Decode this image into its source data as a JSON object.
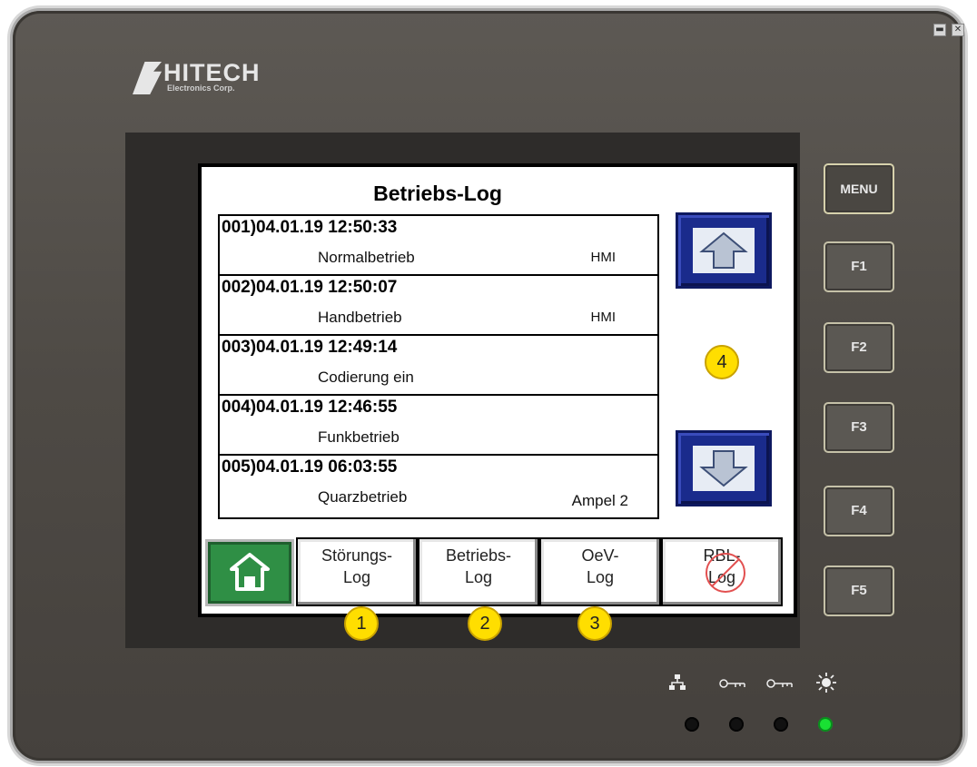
{
  "window_controls": {
    "minimize": "▬",
    "close": "✕"
  },
  "brand": {
    "name": "HITECH",
    "subtitle": "Electronics Corp."
  },
  "screen": {
    "title": "Betriebs-Log",
    "entries": [
      {
        "head": "001)04.01.19 12:50:33",
        "text": "Normalbetrieb",
        "source": "HMI"
      },
      {
        "head": "002)04.01.19 12:50:07",
        "text": "Handbetrieb",
        "source": "HMI"
      },
      {
        "head": "003)04.01.19 12:49:14",
        "text": "Codierung ein",
        "source": ""
      },
      {
        "head": "004)04.01.19 12:46:55",
        "text": "Funkbetrieb",
        "source": ""
      },
      {
        "head": "005)04.01.19 06:03:55",
        "text": "Quarzbetrieb",
        "source": "Ampel 2"
      }
    ],
    "tabs": [
      {
        "line1": "Störungs-",
        "line2": "Log"
      },
      {
        "line1": "Betriebs-",
        "line2": "Log"
      },
      {
        "line1": "OeV-",
        "line2": "Log"
      },
      {
        "line1": "RBL-",
        "line2": "Log"
      }
    ]
  },
  "badges": [
    "1",
    "2",
    "3",
    "4"
  ],
  "side_buttons": [
    "MENU",
    "F1",
    "F2",
    "F3",
    "F4",
    "F5"
  ],
  "status_icons": [
    "network-icon",
    "key-icon",
    "key-icon",
    "light-icon"
  ],
  "leds": [
    false,
    false,
    false,
    true
  ],
  "colors": {
    "nav_blue": "#1a2b8c",
    "home_green": "#2f8f45",
    "badge_yellow": "#ffde00",
    "led_green": "#19e033"
  }
}
